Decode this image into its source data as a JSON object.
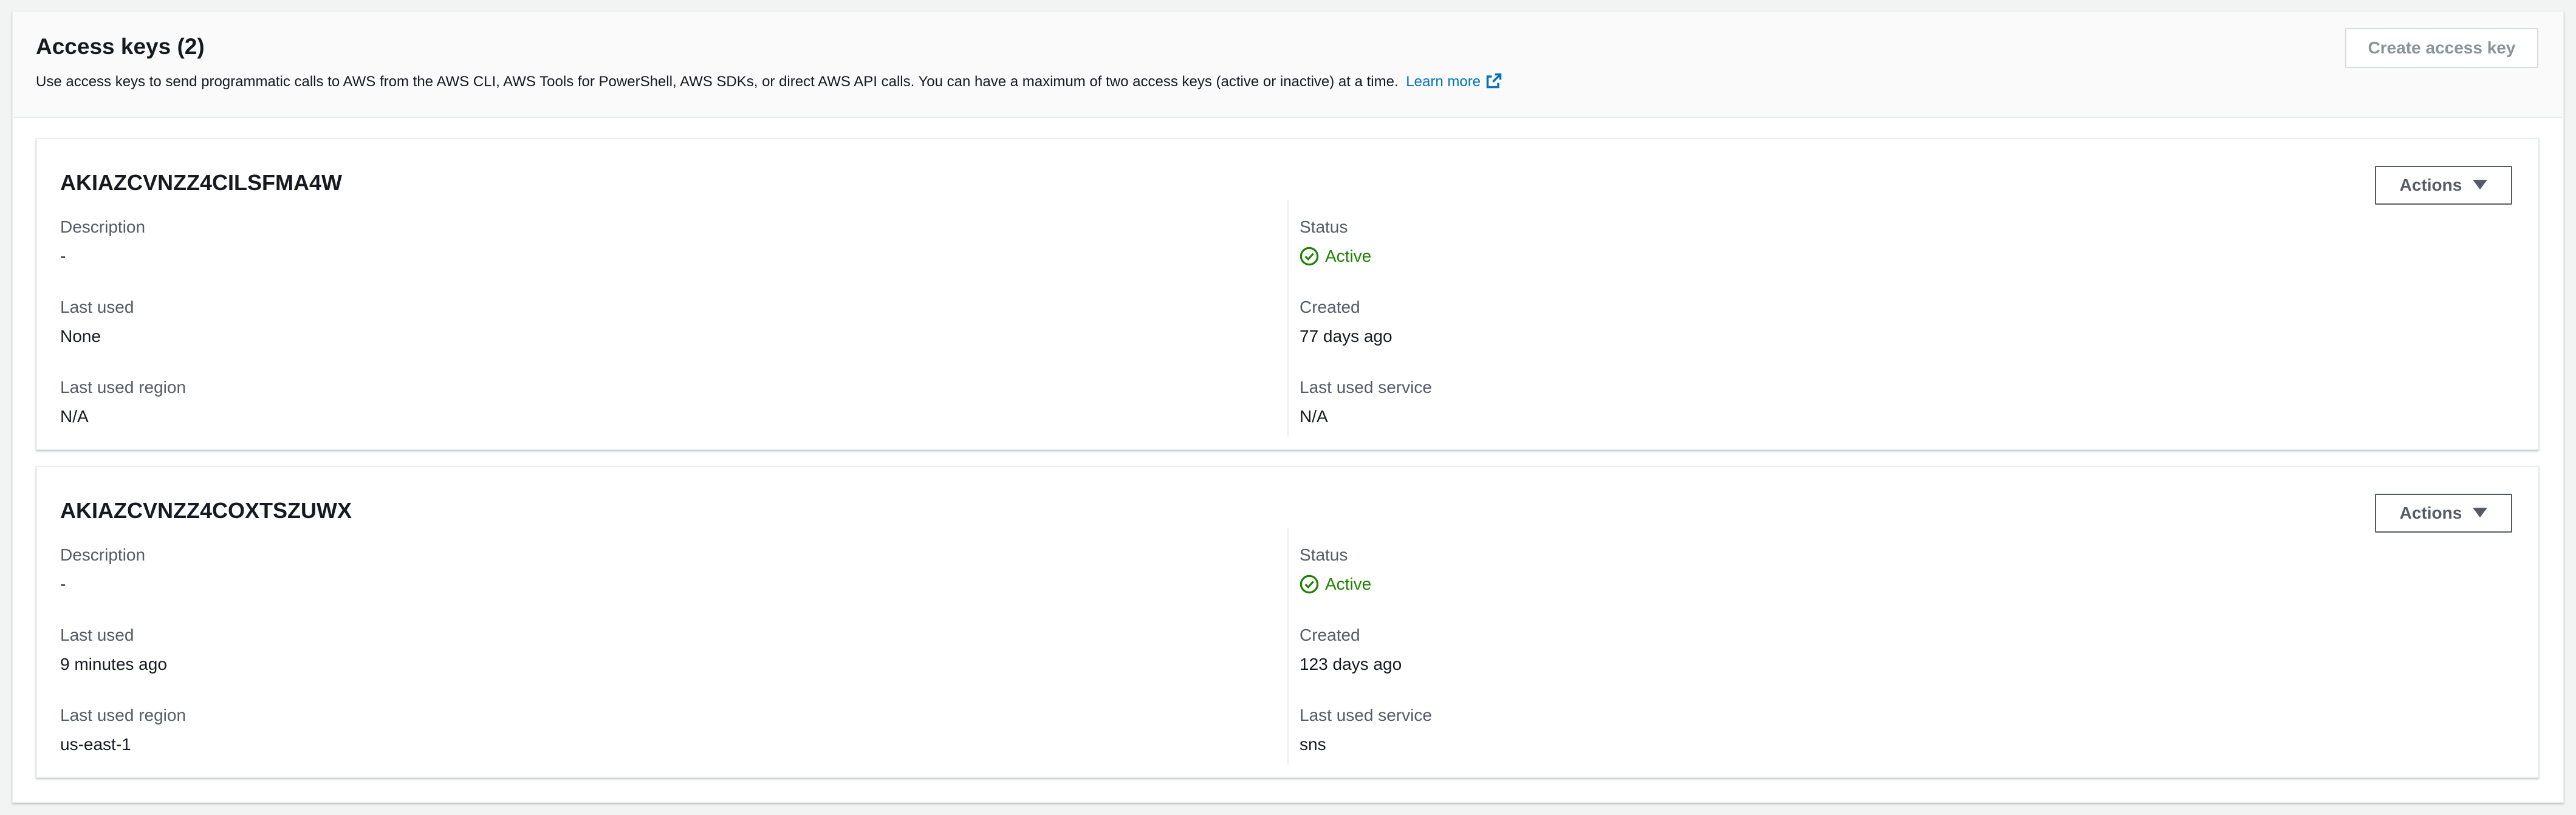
{
  "panel": {
    "title": "Access keys",
    "count": "(2)",
    "description": "Use access keys to send programmatic calls to AWS from the AWS CLI, AWS Tools for PowerShell, AWS SDKs, or direct AWS API calls. You can have a maximum of two access keys (active or inactive) at a time.",
    "learn_more": "Learn more",
    "learn_more_icon": "external-link-icon",
    "create_button": "Create access key"
  },
  "colors": {
    "link": "#0073bb",
    "status_active": "#1d8102",
    "disabled_text": "#879596"
  },
  "keys": [
    {
      "id": "AKIAZCVNZZ4CILSFMA4W",
      "actions_label": "Actions",
      "description_label": "Description",
      "description": "-",
      "last_used_label": "Last used",
      "last_used": "None",
      "last_used_region_label": "Last used region",
      "last_used_region": "N/A",
      "status_label": "Status",
      "status": "Active",
      "status_icon": "check-circle-icon",
      "created_label": "Created",
      "created": "77 days ago",
      "last_used_service_label": "Last used service",
      "last_used_service": "N/A"
    },
    {
      "id": "AKIAZCVNZZ4COXTSZUWX",
      "actions_label": "Actions",
      "description_label": "Description",
      "description": "-",
      "last_used_label": "Last used",
      "last_used": "9 minutes ago",
      "last_used_region_label": "Last used region",
      "last_used_region": "us-east-1",
      "status_label": "Status",
      "status": "Active",
      "status_icon": "check-circle-icon",
      "created_label": "Created",
      "created": "123 days ago",
      "last_used_service_label": "Last used service",
      "last_used_service": "sns"
    }
  ]
}
